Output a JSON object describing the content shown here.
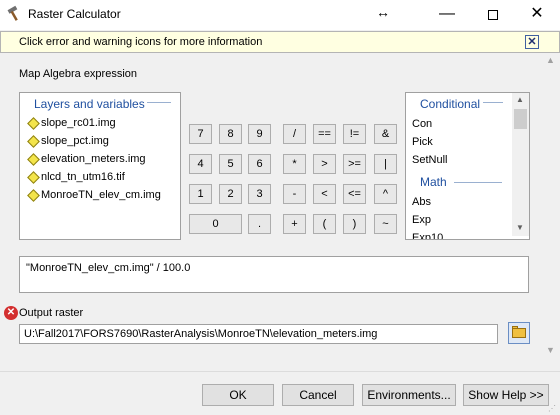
{
  "window": {
    "title": "Raster Calculator",
    "move_glyph": "↔",
    "minimize_glyph": "—",
    "close_glyph": "✕"
  },
  "infobar": {
    "text": "Click error and warning icons for more information",
    "close_glyph": "✕"
  },
  "expression_label": "Map Algebra expression",
  "layers": {
    "header": "Layers and variables",
    "items": [
      "slope_rc01.img",
      "slope_pct.img",
      "elevation_meters.img",
      "nlcd_tn_utm16.tif",
      "MonroeTN_elev_cm.img"
    ]
  },
  "calculator": {
    "row1": [
      "7",
      "8",
      "9",
      "/",
      "==",
      "!=",
      "&"
    ],
    "row2": [
      "4",
      "5",
      "6",
      "*",
      ">",
      ">=",
      "|"
    ],
    "row3": [
      "1",
      "2",
      "3",
      "-",
      "<",
      "<=",
      "^"
    ],
    "row4": [
      "0",
      ".",
      "+",
      "(",
      ")",
      "~"
    ]
  },
  "functions": {
    "conditional_header": "Conditional",
    "conditional_items": [
      "Con",
      "Pick",
      "SetNull"
    ],
    "math_header": "Math",
    "math_items": [
      "Abs",
      "Exp",
      "Exp10"
    ]
  },
  "expression": {
    "value": "\"MonroeTN_elev_cm.img\" / 100.0"
  },
  "output": {
    "label": "Output raster",
    "error_glyph": "✕",
    "value": "U:\\Fall2017\\FORS7690\\RasterAnalysis\\MonroeTN\\elevation_meters.img"
  },
  "buttons": {
    "ok": "OK",
    "cancel": "Cancel",
    "environments": "Environments...",
    "help": "Show Help >>"
  },
  "icons": {
    "title": "hammer-icon",
    "browse": "folder-icon",
    "error": "error-icon"
  },
  "colors": {
    "infobar_bg": "#ffffe1",
    "panel_header": "#2050a0",
    "error": "#d32f2f",
    "layer_diamond": "#f3e44a"
  }
}
